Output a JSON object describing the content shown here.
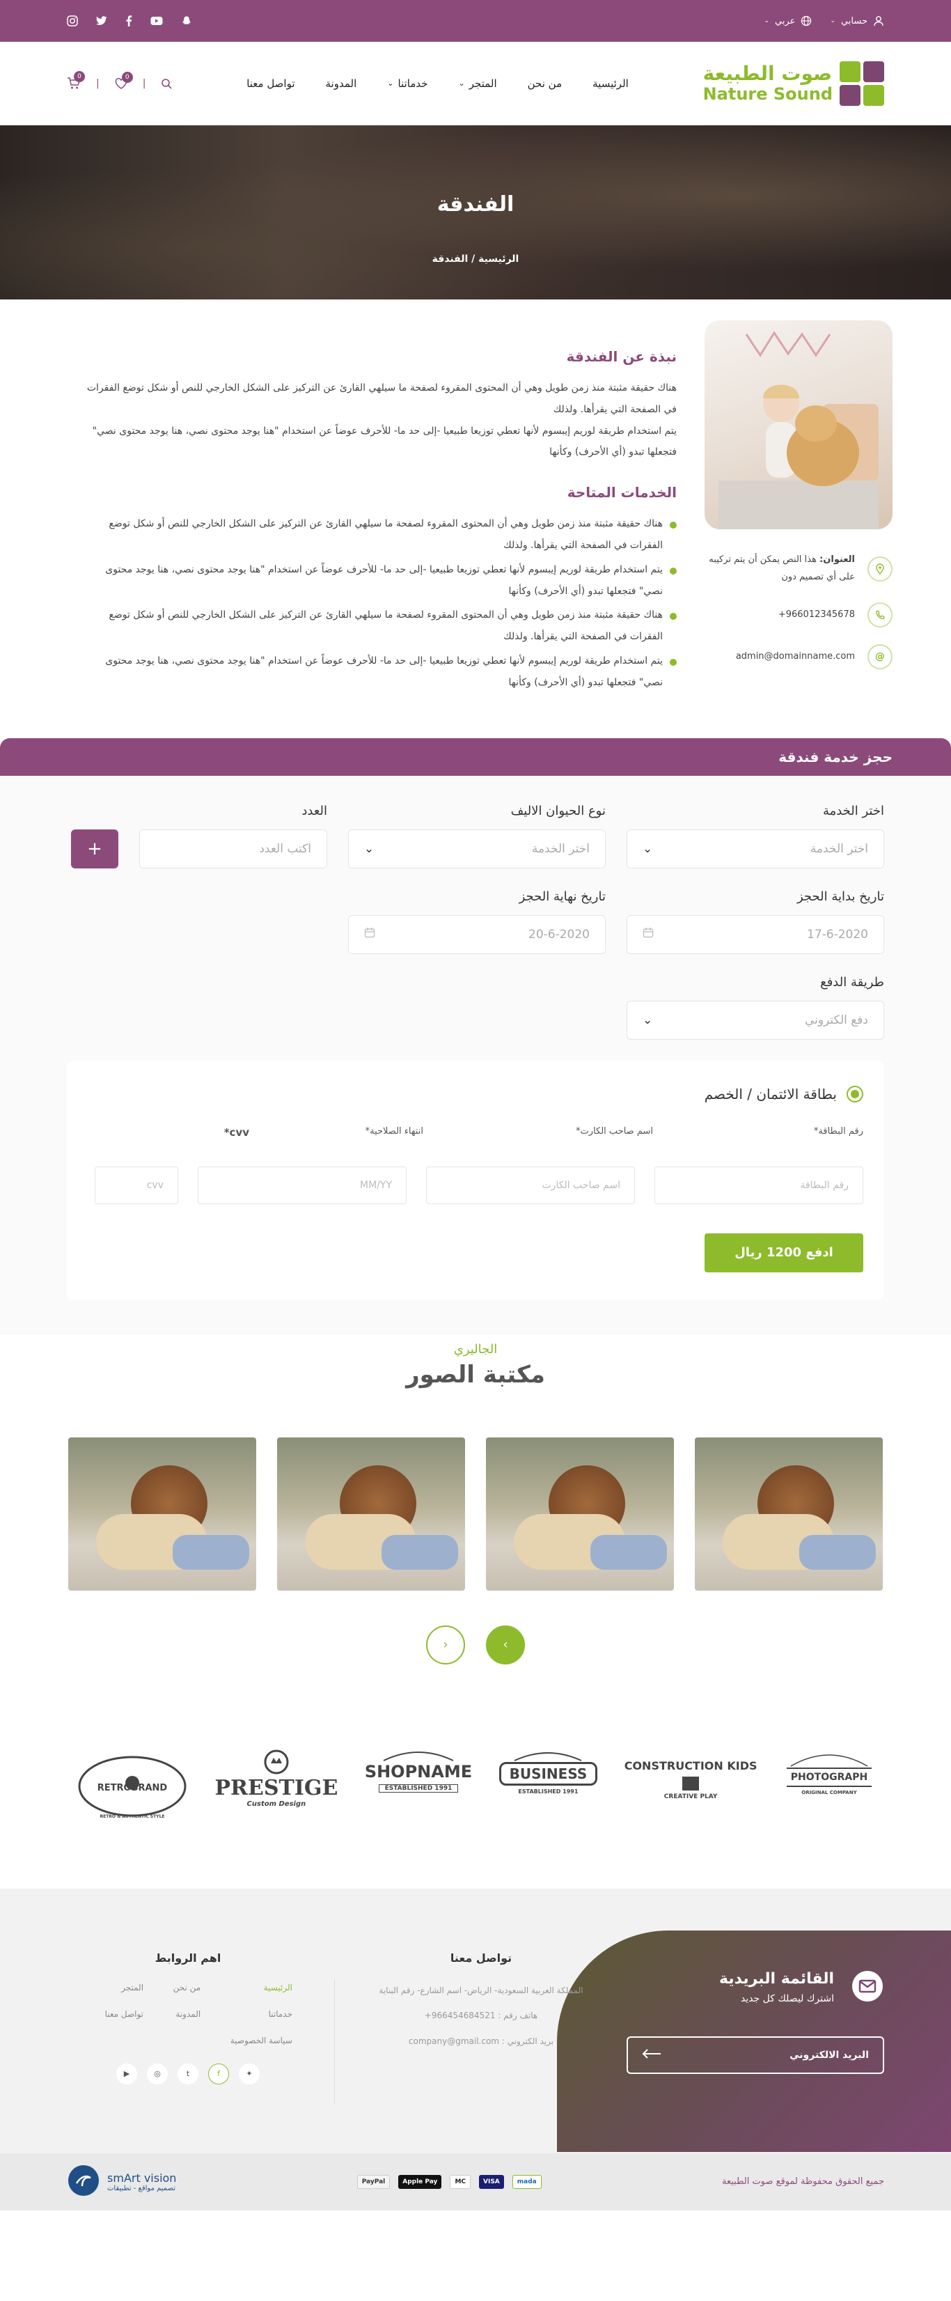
{
  "topbar": {
    "account": "حسابي",
    "language": "عربي",
    "socials": [
      "snapchat-icon",
      "youtube-icon",
      "facebook-icon",
      "twitter-icon",
      "instagram-icon"
    ]
  },
  "header": {
    "logo_ar": "صوت الطبيعة",
    "logo_en": "Nature Sound",
    "nav": [
      "الرئيسية",
      "من نحن",
      "المتجر",
      "خدماتنا",
      "المدونة",
      "تواصل معنا"
    ],
    "wishlist_count": "0",
    "cart_count": "0"
  },
  "hero": {
    "title": "الفندقة",
    "crumb_home": "الرئيسية",
    "crumb_sep": "/",
    "crumb_current": "الفندقة"
  },
  "about": {
    "title": "نبذة عن الفندقة",
    "paragraph1": "هناك حقيقة مثبتة منذ زمن طويل وهي أن المحتوى المقروء لصفحة ما سيلهي القارئ عن التركيز على الشكل الخارجي للنص أو شكل توضع الفقرات في الصفحة التي يقرأها. ولذلك",
    "paragraph2": "يتم استخدام طريقة لوريم إيبسوم لأنها تعطي توزيعا طبيعيا -إلى حد ما- للأحرف عوضاً عن استخدام \"هنا يوجد محتوى نصي، هنا يوجد محتوى نصي\" فتجعلها تبدو (أي الأحرف) وكأنها",
    "services_title": "الخدمات المتاحة",
    "services": [
      "هناك حقيقة مثبتة منذ زمن طويل وهي أن المحتوى المقروء لصفحة ما سيلهي القارئ عن التركيز على الشكل الخارجي للنص أو شكل توضع الفقرات في الصفحة التي يقرأها. ولذلك",
      "يتم استخدام طريقة لوريم إيبسوم لأنها تعطي توزيعا طبيعيا -إلى حد ما- للأحرف عوضاً عن استخدام \"هنا يوجد محتوى نصي، هنا يوجد محتوى نصي\" فتجعلها تبدو (أي الأحرف) وكأنها",
      "هناك حقيقة مثبتة منذ زمن طويل وهي أن المحتوى المقروء لصفحة ما سيلهي القارئ عن التركيز على الشكل الخارجي للنص أو شكل توضع الفقرات في الصفحة التي يقرأها. ولذلك",
      "يتم استخدام طريقة لوريم إيبسوم لأنها تعطي توزيعا طبيعيا -إلى حد ما- للأحرف عوضاً عن استخدام \"هنا يوجد محتوى نصي، هنا يوجد محتوى نصي\" فتجعلها تبدو (أي الأحرف) وكأنها"
    ],
    "address_label": "العنوان:",
    "address": "هذا النص يمكن أن يتم تركيبه على أي تصميم دون",
    "phone": "+966012345678",
    "email": "admin@domainname.com"
  },
  "booking": {
    "bar_title": "حجز خدمة فندقة",
    "service_label": "اختر الخدمة",
    "service_placeholder": "اختر الخدمة",
    "pet_label": "نوع الحيوان الاليف",
    "pet_placeholder": "اختر الخدمة",
    "count_label": "العدد",
    "count_placeholder": "اكتب العدد",
    "plus": "+",
    "start_label": "تاريخ بداية الحجز",
    "start_value": "17-6-2020",
    "end_label": "تاريخ نهاية الحجز",
    "end_value": "20-6-2020",
    "payment_label": "طريقة الدفع",
    "payment_value": "دفع الكتروني",
    "card_option": "بطاقة الائتمان / الخصم",
    "card_number_label": "رقم البطاقة*",
    "card_holder_label": "اسم صاحب الكارت*",
    "expiry_label": "انتهاء الصلاحية*",
    "cvv_label": "cvv*",
    "card_number_placeholder": "رقم البطاقة",
    "card_holder_placeholder": "اسم صاحب الكارت",
    "expiry_placeholder": "MM/YY",
    "cvv_placeholder": "cvv",
    "pay_button": "ادفع 1200 ريال"
  },
  "gallery": {
    "subtitle": "الجاليري",
    "title": "مكتبة الصور"
  },
  "brands": [
    {
      "name": "RETROBRAND",
      "sub": "RETRO & AUTHENTIC STYLE"
    },
    {
      "name": "PRESTIGE",
      "sub": "Custom Design"
    },
    {
      "name": "SHOPNAME",
      "sub": "ESTABLISHED 1991"
    },
    {
      "name": "BUSINESS",
      "sub": "ESTABLISHED 1991"
    },
    {
      "name": "CONSTRUCTION KIDS",
      "sub": "CREATIVE PLAY"
    },
    {
      "name": "PHOTOGRAPH",
      "sub": "ORIGINAL COMPANY"
    }
  ],
  "footer": {
    "newsletter_title": "القائمة البريدية",
    "newsletter_sub": "اشترك ليصلك كل جديد",
    "email_placeholder": "البريد الالكتروني",
    "links_title": "اهم الروابط",
    "links": [
      "الرئيسية",
      "من نحن",
      "المتجر",
      "خدماتنا",
      "المدونة",
      "تواصل معنا",
      "سياسة الخصوصية"
    ],
    "contact_title": "تواصل معنا",
    "address": "المملكة العربية السعودية- الرياض- اسم الشارع- رقم البناية",
    "phone": "هاتف رقم : 966454684521+",
    "email": "بريد الكتروني : company@gmail.com",
    "copyright": "جميع الحقوق محفوظة لموقع صوت الطبيعة",
    "payments": [
      "mada",
      "VISA",
      "MC",
      "Apple Pay",
      "PayPal"
    ],
    "credit_name": "smArt vision",
    "credit_sub": "تصميم مواقع - تطبيقات"
  },
  "colors": {
    "primary": "#8c4a7b",
    "accent": "#8dbb2b"
  }
}
